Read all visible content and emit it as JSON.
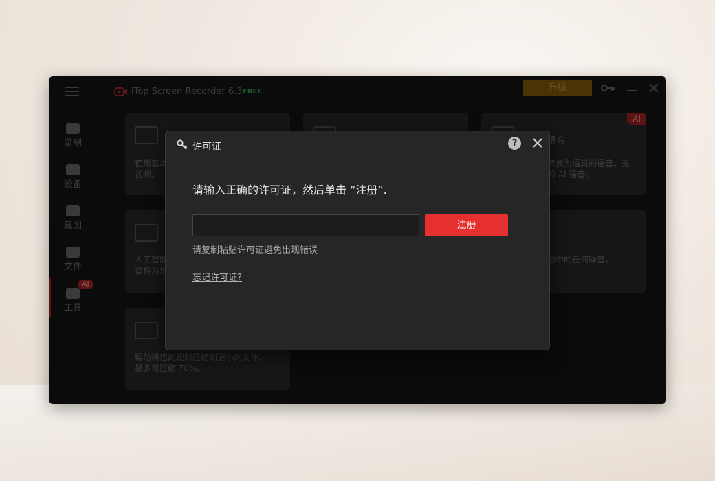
{
  "app": {
    "title": "iTop Screen Recorder 6.3",
    "edition_badge": "FREE",
    "upgrade_label": "升级"
  },
  "sidebar": {
    "items": [
      {
        "label": "录制",
        "icon": "camera-icon"
      },
      {
        "label": "设备",
        "icon": "device-icon"
      },
      {
        "label": "截图",
        "icon": "screenshot-icon"
      },
      {
        "label": "文件",
        "icon": "folder-icon"
      },
      {
        "label": "工具",
        "icon": "tools-icon"
      }
    ],
    "tools_badge": "AI"
  },
  "cards": [
    {
      "desc_line1": "使用基本",
      "desc_line2": "视频。"
    },
    {
      "title_partial": "语音",
      "desc_line1": "转换为逼真的语音。支",
      "desc_line2": "的 AI 语音。",
      "badge": "AI"
    },
    {
      "desc_line1": "人工智能",
      "desc_line2": "替换为您"
    },
    {
      "desc_line1": "频中的任何噪音。"
    },
    {
      "desc_line1": "帮助将您的视频压缩到更小的文件,",
      "desc_line2": "最多可压缩 70%。"
    }
  ],
  "dialog": {
    "title": "许可证",
    "instruction": "请输入正确的许可证，然后单击 “注册”.",
    "input_value": "",
    "register_label": "注册",
    "paste_hint": "请复制粘贴许可证避免出现错误",
    "forgot_link": "忘记许可证?",
    "help_symbol": "?"
  },
  "colors": {
    "accent_red": "#e5302f",
    "dialog_bg": "#262626",
    "window_bg": "#0b0b0b"
  }
}
